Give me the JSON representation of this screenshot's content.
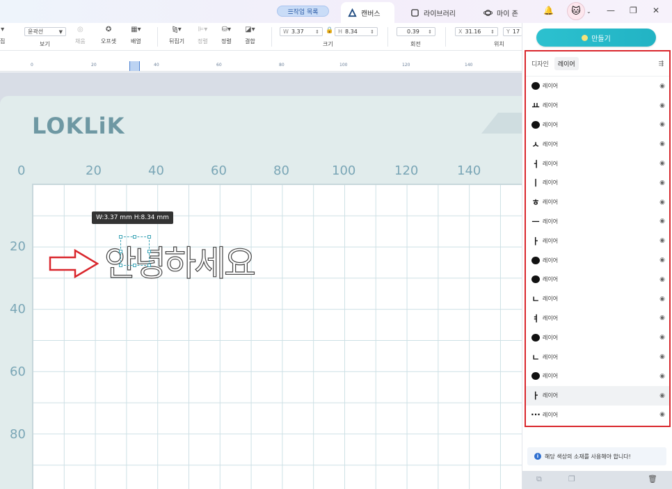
{
  "titlebar": {
    "tasklist_label": "☰작업 목록",
    "tabs": [
      {
        "label": "캔버스",
        "active": true
      },
      {
        "label": "라이브러리",
        "active": false
      },
      {
        "label": "마이 존",
        "active": false
      }
    ],
    "bell": "🔔",
    "avatar": "🐱",
    "minimize": "—",
    "restore": "❐",
    "close": "✕"
  },
  "toolbar": {
    "edit_label": "집",
    "view_select": "윤곽선",
    "view_label": "보기",
    "fill_label": "채움",
    "offset_label": "오프셋",
    "arrange_label": "배열",
    "flip_label": "뒤집기",
    "align_label": "정렬",
    "sort_label": "정렬",
    "combine_label": "결합",
    "size": {
      "w_prefix": "W",
      "w": "3.37",
      "h_prefix": "H",
      "h": "8.34",
      "label": "크기"
    },
    "rotate": {
      "value": "0.39",
      "label": "회전"
    },
    "position": {
      "x_prefix": "X",
      "x": "31.16",
      "y_prefix": "Y",
      "y": "17",
      "label": "위치"
    }
  },
  "top_ruler": {
    "labels": [
      "0",
      "20",
      "40",
      "60",
      "80",
      "100",
      "120",
      "140"
    ]
  },
  "canvas": {
    "logo": "LOKLiK",
    "ruler_x": [
      "0",
      "20",
      "40",
      "60",
      "80",
      "100",
      "120",
      "140"
    ],
    "ruler_y": [
      "20",
      "40",
      "60",
      "80"
    ],
    "tooltip": "W:3.37 mm  H:8.34 mm",
    "text": "안녕하세요"
  },
  "right_panel": {
    "make_button": "만들기",
    "tabs": [
      {
        "label": "디자인",
        "active": false
      },
      {
        "label": "레이어",
        "active": true
      }
    ],
    "layers": [
      {
        "thumb": "dot",
        "name": "레이어"
      },
      {
        "thumb": "ㅛ",
        "name": "레이어"
      },
      {
        "thumb": "dot",
        "name": "레이어"
      },
      {
        "thumb": "ㅅ",
        "name": "레이어"
      },
      {
        "thumb": "ㅓ",
        "name": "레이어"
      },
      {
        "thumb": "ㅣ",
        "name": "레이어"
      },
      {
        "thumb": "ㅎ",
        "name": "레이어"
      },
      {
        "thumb": "ㅡ",
        "name": "레이어"
      },
      {
        "thumb": "ㅏ",
        "name": "레이어"
      },
      {
        "thumb": "dot",
        "name": "레이어"
      },
      {
        "thumb": "dot",
        "name": "레이어"
      },
      {
        "thumb": "ㄴ",
        "name": "레이어"
      },
      {
        "thumb": "ㅕ",
        "name": "레이어"
      },
      {
        "thumb": "dot",
        "name": "레이어"
      },
      {
        "thumb": "ㄴ",
        "name": "레이어"
      },
      {
        "thumb": "dot",
        "name": "레이어"
      },
      {
        "thumb": "ㅏ",
        "name": "레이어",
        "selected": true
      },
      {
        "thumb": "···",
        "name": "레이어"
      }
    ],
    "notice": "해당 색상의 소재를 사용해야 합니다!"
  },
  "colors": {
    "accent": "#22b3c4",
    "highlight": "#d9262c",
    "mat": "#e1ecec"
  }
}
